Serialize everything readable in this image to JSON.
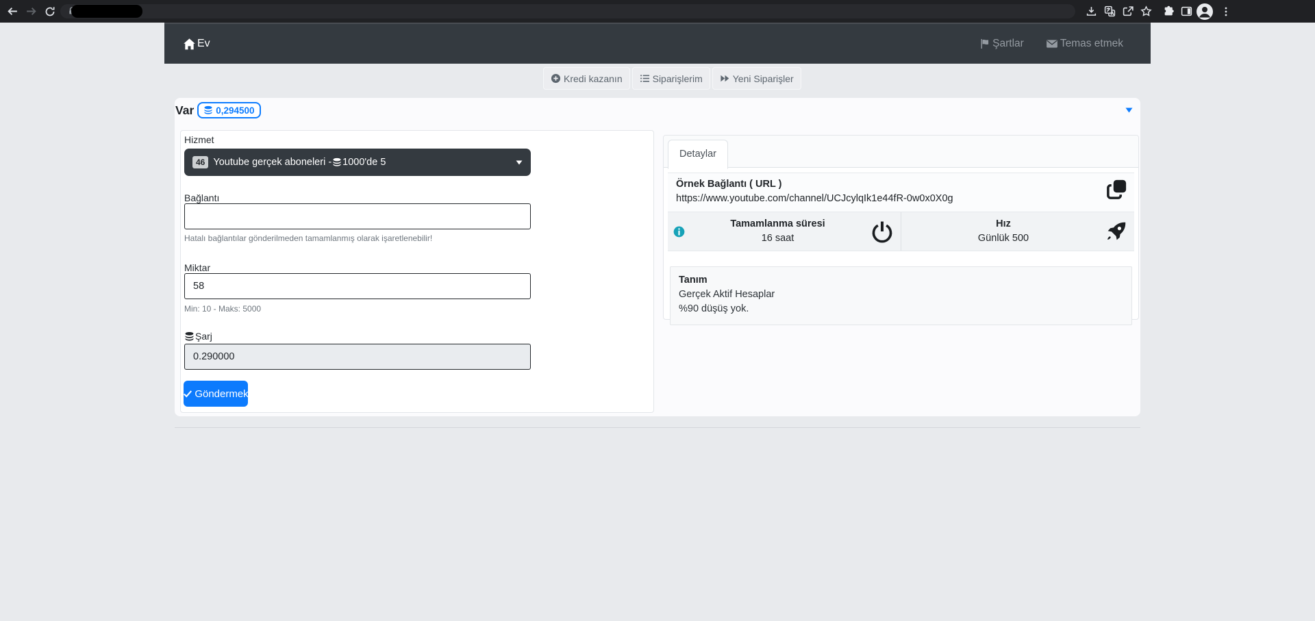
{
  "browser": {
    "toolbar_icons": [
      "back-icon",
      "forward-icon",
      "reload-icon",
      "lock-icon",
      "download-icon",
      "translate-icon",
      "share-icon",
      "star-icon",
      "extensions-icon",
      "side-panel-icon",
      "profile-icon",
      "menu-icon"
    ],
    "url_redacted": true
  },
  "navbar": {
    "brand": "Ev",
    "brand_icon": "home-icon",
    "links": [
      {
        "label": "Şartlar",
        "icon": "flag-icon"
      },
      {
        "label": "Temas etmek",
        "icon": "envelope-icon"
      }
    ]
  },
  "toolbar_buttons": [
    {
      "label": "Kredi kazanın",
      "icon": "plus-circle-icon"
    },
    {
      "label": "Siparişlerim",
      "icon": "list-icon"
    },
    {
      "label": "Yeni Siparişler",
      "icon": "forward-icon"
    }
  ],
  "balance": {
    "label": "Var",
    "amount": "0,294500",
    "icon": "coins-icon"
  },
  "order_form": {
    "service_label": "Hizmet",
    "service_id": "46",
    "service_name_prefix": "Youtube gerçek aboneleri -",
    "service_name_suffix": "1000'de 5",
    "link_label": "Bağlantı",
    "link_value": "",
    "link_help": "Hatalı bağlantılar gönderilmeden tamamlanmış olarak işaretlenebilir!",
    "quantity_label": "Miktar",
    "quantity_value": "58",
    "quantity_help": "Min: 10 - Maks: 5000",
    "charge_label": "Şarj",
    "charge_value": "0.290000",
    "submit_label": "Göndermek"
  },
  "details": {
    "tab_label": "Detaylar",
    "example_link_label": "Örnek Bağlantı ( URL )",
    "example_link_url": "https://www.youtube.com/channel/UCJcylqIk1e44fR-0w0x0X0g",
    "completion_label": "Tamamlanma süresi",
    "completion_value": "16 saat",
    "speed_label": "Hız",
    "speed_value": "Günlük 500",
    "description_label": "Tanım",
    "description_lines": [
      "Gerçek Aktif Hesaplar",
      "%90 düşüş yok."
    ]
  },
  "colors": {
    "primary": "#0d7bfd",
    "navbar": "#343a40",
    "info": "#17a2b8",
    "page_background": "#e8eaed"
  }
}
